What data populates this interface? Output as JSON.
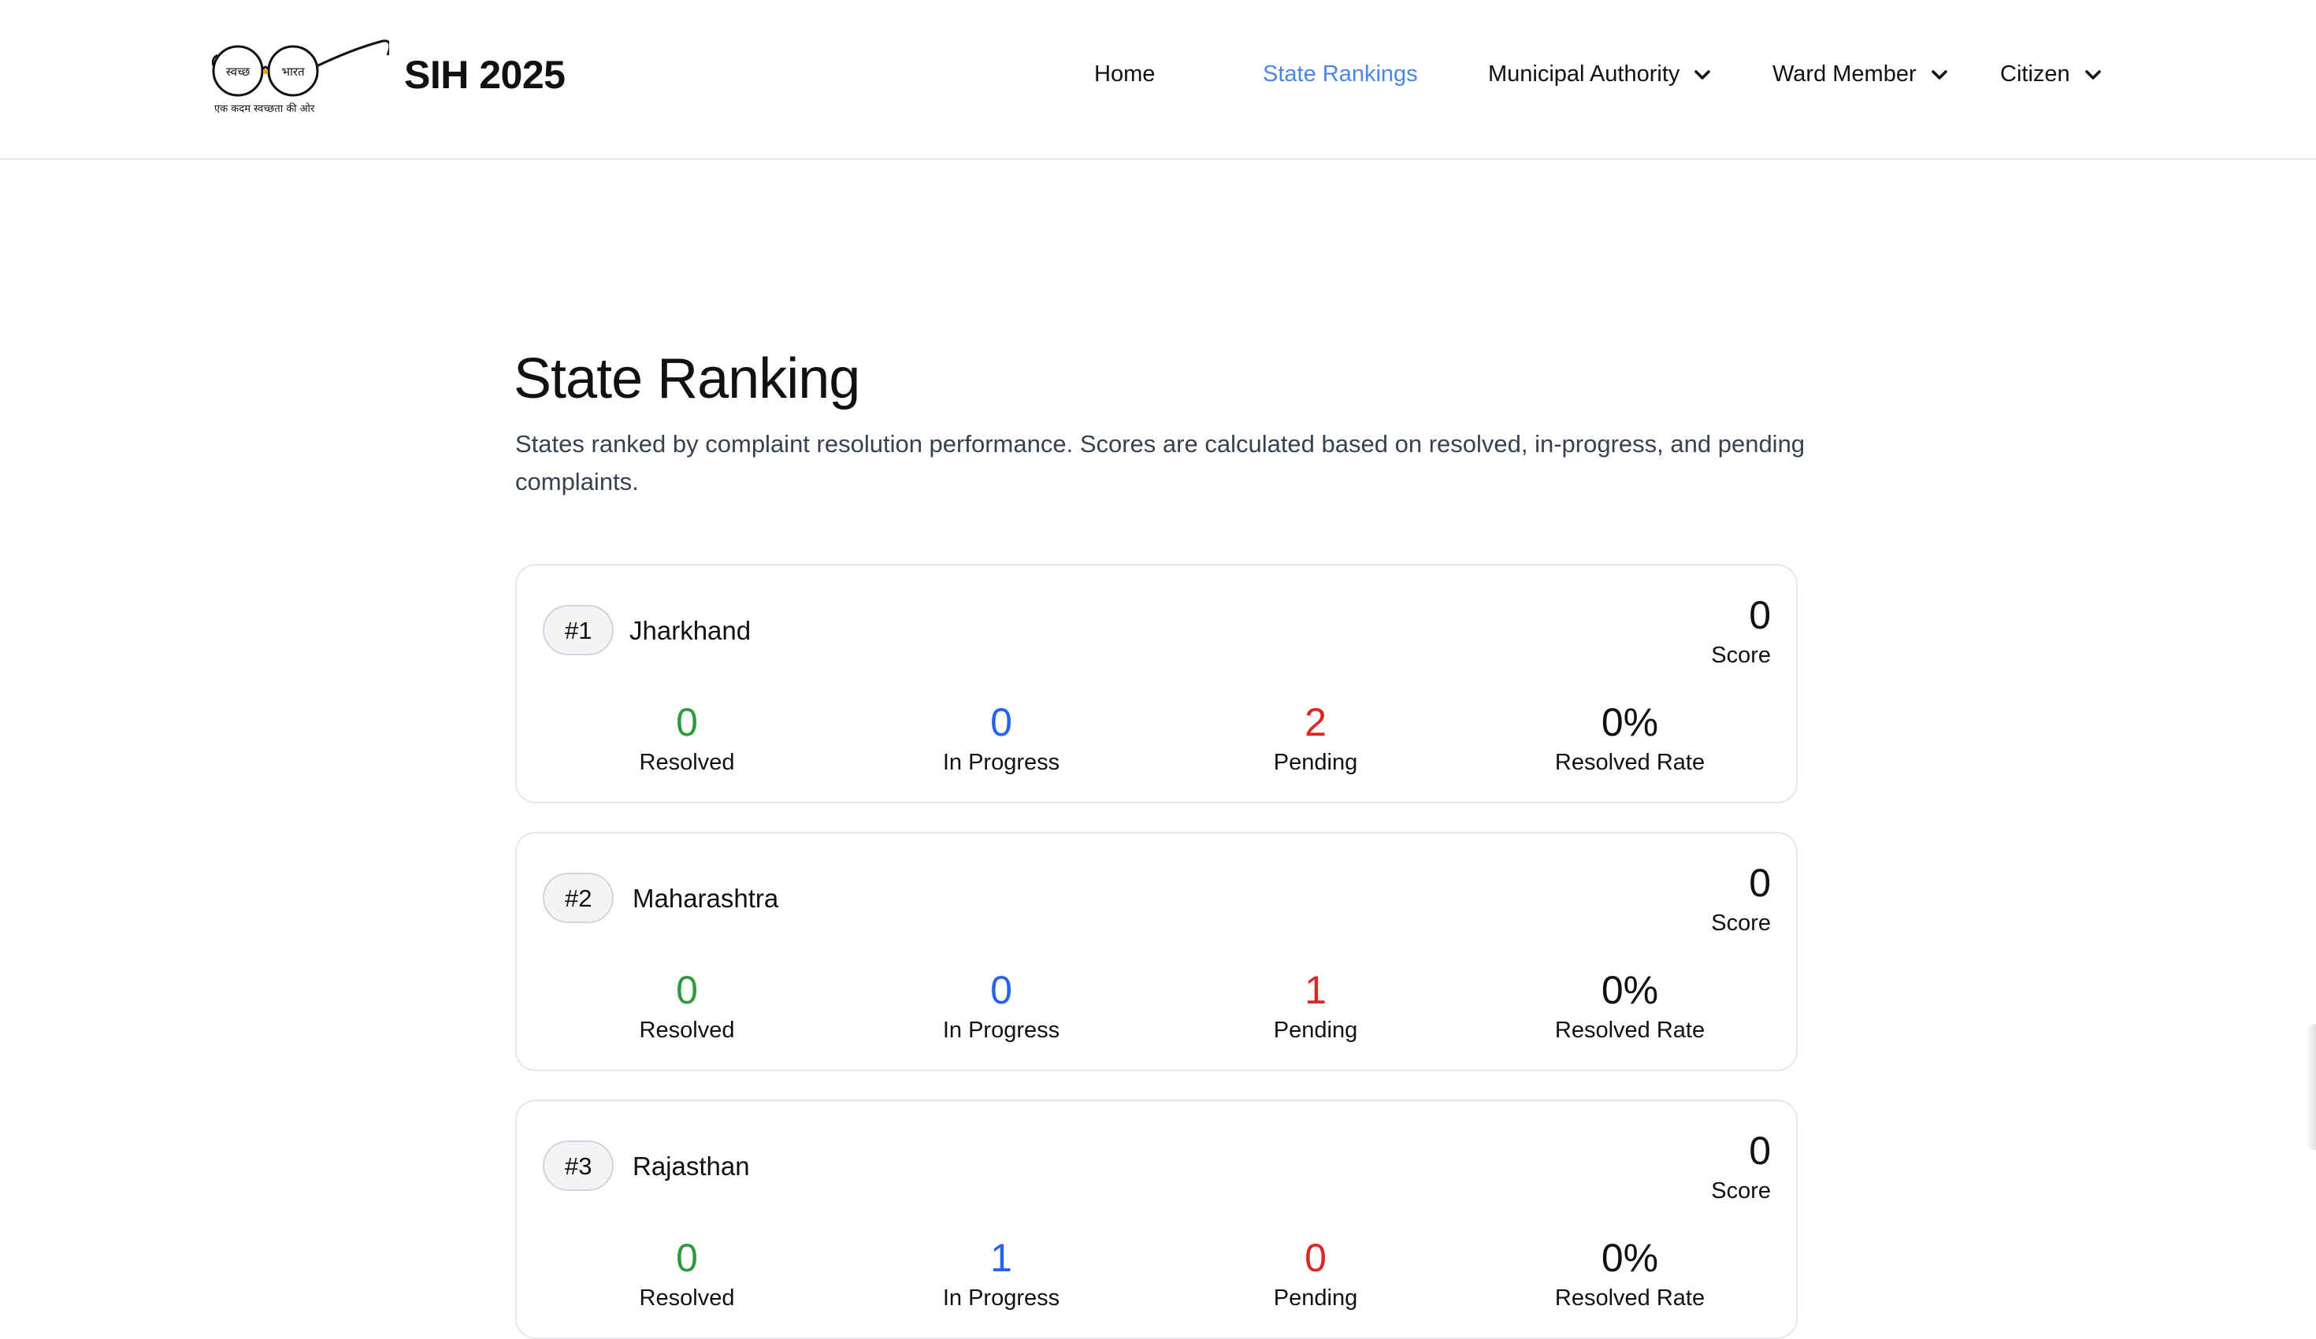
{
  "header": {
    "logo": {
      "icon": "swachh-bharat-glasses-logo",
      "text_left": "स्वच्छ",
      "text_right": "भारत",
      "tagline": "एक कदम स्वच्छता की ओर"
    },
    "brand": "SIH 2025",
    "nav": [
      {
        "label": "Home",
        "active": false,
        "dropdown": false
      },
      {
        "label": "State Rankings",
        "active": true,
        "dropdown": false
      },
      {
        "label": "Municipal Authority",
        "active": false,
        "dropdown": true
      },
      {
        "label": "Ward Member",
        "active": false,
        "dropdown": true
      },
      {
        "label": "Citizen",
        "active": false,
        "dropdown": true
      }
    ]
  },
  "main": {
    "title": "State Ranking",
    "description": "States ranked by complaint resolution performance. Scores are calculated based on resolved, in-progress, and pending complaints.",
    "score_label": "Score",
    "stat_labels": {
      "resolved": "Resolved",
      "in_progress": "In Progress",
      "pending": "Pending",
      "resolved_rate": "Resolved Rate"
    },
    "states": [
      {
        "rank": "#1",
        "name": "Jharkhand",
        "score": "0",
        "resolved": "0",
        "in_progress": "0",
        "pending": "2",
        "resolved_rate": "0%"
      },
      {
        "rank": "#2",
        "name": "Maharashtra",
        "score": "0",
        "resolved": "0",
        "in_progress": "0",
        "pending": "1",
        "resolved_rate": "0%"
      },
      {
        "rank": "#3",
        "name": "Rajasthan",
        "score": "0",
        "resolved": "0",
        "in_progress": "1",
        "pending": "0",
        "resolved_rate": "0%"
      }
    ]
  },
  "colors": {
    "active_nav": "#4a86e8",
    "resolved": "#2e9b3e",
    "in_progress": "#2563eb",
    "pending": "#dc2626"
  }
}
